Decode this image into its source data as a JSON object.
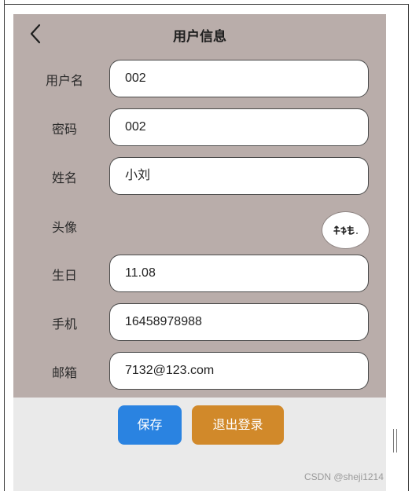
{
  "header": {
    "title": "用户信息",
    "back_icon": "chevron-left-icon"
  },
  "fields": {
    "username": {
      "label": "用户名",
      "value": "002"
    },
    "password": {
      "label": "密码",
      "value": "002"
    },
    "name": {
      "label": "姓名",
      "value": "小刘"
    },
    "avatar": {
      "label": "头像",
      "image_text": "炸麓."
    },
    "birthday": {
      "label": "生日",
      "value": "11.08"
    },
    "phone": {
      "label": "手机",
      "value": "16458978988"
    },
    "email": {
      "label": "邮箱",
      "value": "7132@123.com"
    }
  },
  "actions": {
    "save_label": "保存",
    "logout_label": "退出登录"
  },
  "colors": {
    "panel_bg": "#b9adaa",
    "save_button": "#2a83e1",
    "logout_button": "#d1892a",
    "footer_bg": "#eaeaea"
  },
  "watermark": "CSDN @sheji1214"
}
